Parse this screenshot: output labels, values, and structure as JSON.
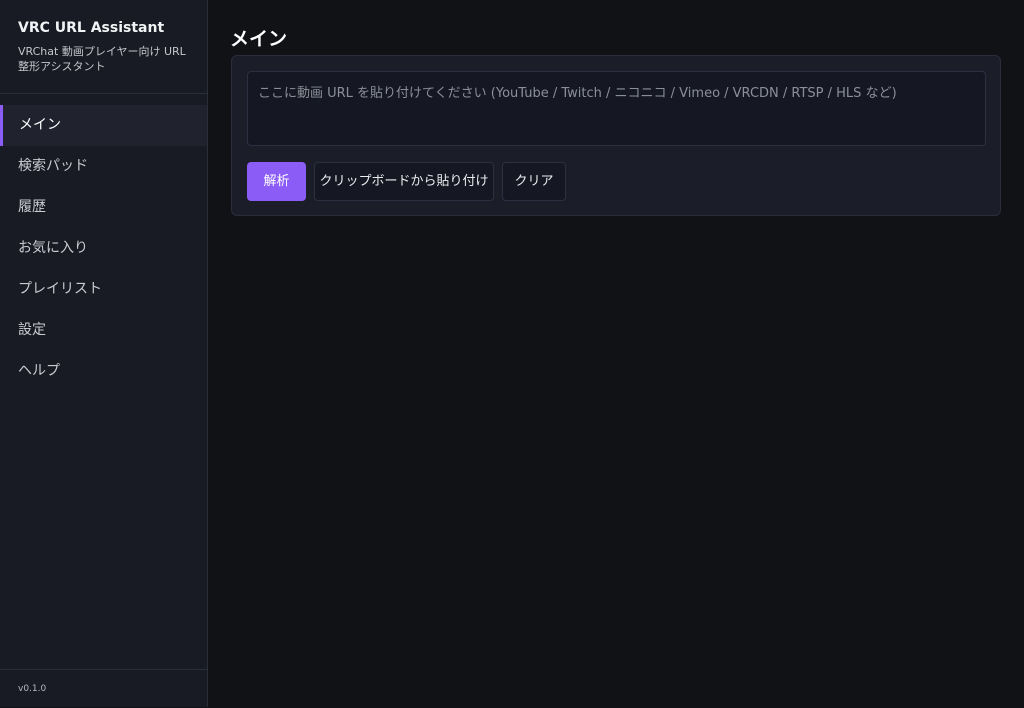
{
  "app": {
    "title": "VRC URL Assistant",
    "subtitle": "VRChat 動画プレイヤー向け URL 整形アシスタント",
    "version": "v0.1.0"
  },
  "sidebar": {
    "items": [
      {
        "label": "メイン",
        "active": true
      },
      {
        "label": "検索パッド",
        "active": false
      },
      {
        "label": "履歴",
        "active": false
      },
      {
        "label": "お気に入り",
        "active": false
      },
      {
        "label": "プレイリスト",
        "active": false
      },
      {
        "label": "設定",
        "active": false
      },
      {
        "label": "ヘルプ",
        "active": false
      }
    ]
  },
  "main": {
    "title": "メイン",
    "url_input": {
      "value": "",
      "placeholder": "ここに動画 URL を貼り付けてください (YouTube / Twitch / ニコニコ / Vimeo / VRCDN / RTSP / HLS など)"
    },
    "buttons": {
      "analyze": "解析",
      "paste": "クリップボードから貼り付け",
      "clear": "クリア"
    }
  },
  "colors": {
    "accent": "#8b5cf6",
    "background": "#111216",
    "sidebar": "#181b24",
    "card": "#1b1e29"
  }
}
